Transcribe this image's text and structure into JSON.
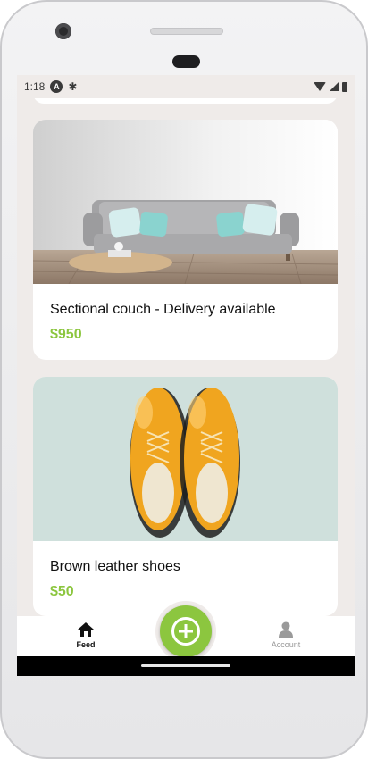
{
  "status_bar": {
    "time": "1:18",
    "icons": [
      "a-icon",
      "bug-icon",
      "wifi-icon",
      "signal-icon",
      "battery-icon"
    ]
  },
  "feed": {
    "items": [
      {
        "title": "Sectional couch - Delivery available",
        "price": "$950",
        "image": "sofa-image"
      },
      {
        "title": "Brown leather shoes",
        "price": "$50",
        "image": "shoes-image"
      }
    ]
  },
  "tabbar": {
    "feed_label": "Feed",
    "account_label": "Account",
    "add_icon": "plus-circle-icon",
    "active_tab": "Feed"
  },
  "colors": {
    "accent": "#8cc63f",
    "background": "#efebe9",
    "card": "#ffffff",
    "text": "#111111",
    "inactive": "#9a9a9a"
  }
}
